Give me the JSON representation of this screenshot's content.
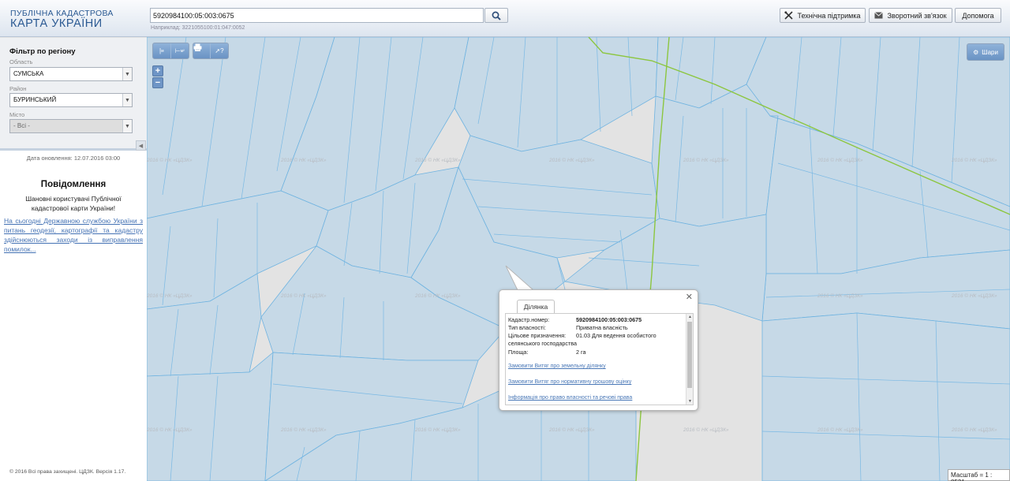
{
  "header": {
    "logo_line1": "ПУБЛІЧНА КАДАСТРОВА",
    "logo_line2": "КАРТА УКРАЇНИ",
    "search_value": "5920984100:05:003:0675",
    "search_hint": "Наприклад: 3221055100:01:047:0052",
    "buttons": [
      {
        "label": "Технічна підтримка",
        "icon": "tools-icon"
      },
      {
        "label": "Зворотний зв'язок",
        "icon": "envelope-icon"
      },
      {
        "label": "Допомога",
        "icon": ""
      }
    ]
  },
  "sidebar": {
    "filter_title": "Фільтр по регіону",
    "region_label": "Область",
    "region_value": "СУМСЬКА",
    "district_label": "Район",
    "district_value": "БУРИНСЬКИЙ",
    "city_label": "Місто",
    "city_value": "- Всі -",
    "update_text": "Дата оновлення: 12.07.2016 03:00",
    "notice_title": "Повідомлення",
    "notice_body": "Шановні користувачі Публічної кадастрової карти України!",
    "notice_link": "На сьогодні Державною службою України з питань геодезії, картографії та кадастру здійснюються заходи із виправлення помилок...",
    "copyright": "© 2016 Всі права захищені. ЦДЗК. Версія 1.17."
  },
  "map": {
    "tools": [
      "measure-line-icon",
      "measure-area-icon",
      "print-icon",
      "identify-icon"
    ],
    "layers_label": "Шари",
    "scale_text": "Масштаб = 1 : 8531",
    "watermark": "2016 © НК «ЦДЗК»"
  },
  "popup": {
    "tab": "Ділянка",
    "rows": [
      {
        "k": "Кадастр.номер:",
        "v": "5920984100:05:003:0675"
      },
      {
        "k": "Тип власності:",
        "v": "Приватна власність"
      },
      {
        "k": "Цільове призначення:",
        "v": "01.03 Для ведення особистого селянського господарства"
      },
      {
        "k": "Площа:",
        "v": "2 га"
      }
    ],
    "links": [
      "Замовити Витяг про земельну ділянку",
      "Замовити Витяг про нормативну грошову оцінку",
      "Інформація про право власності та речові права"
    ]
  }
}
